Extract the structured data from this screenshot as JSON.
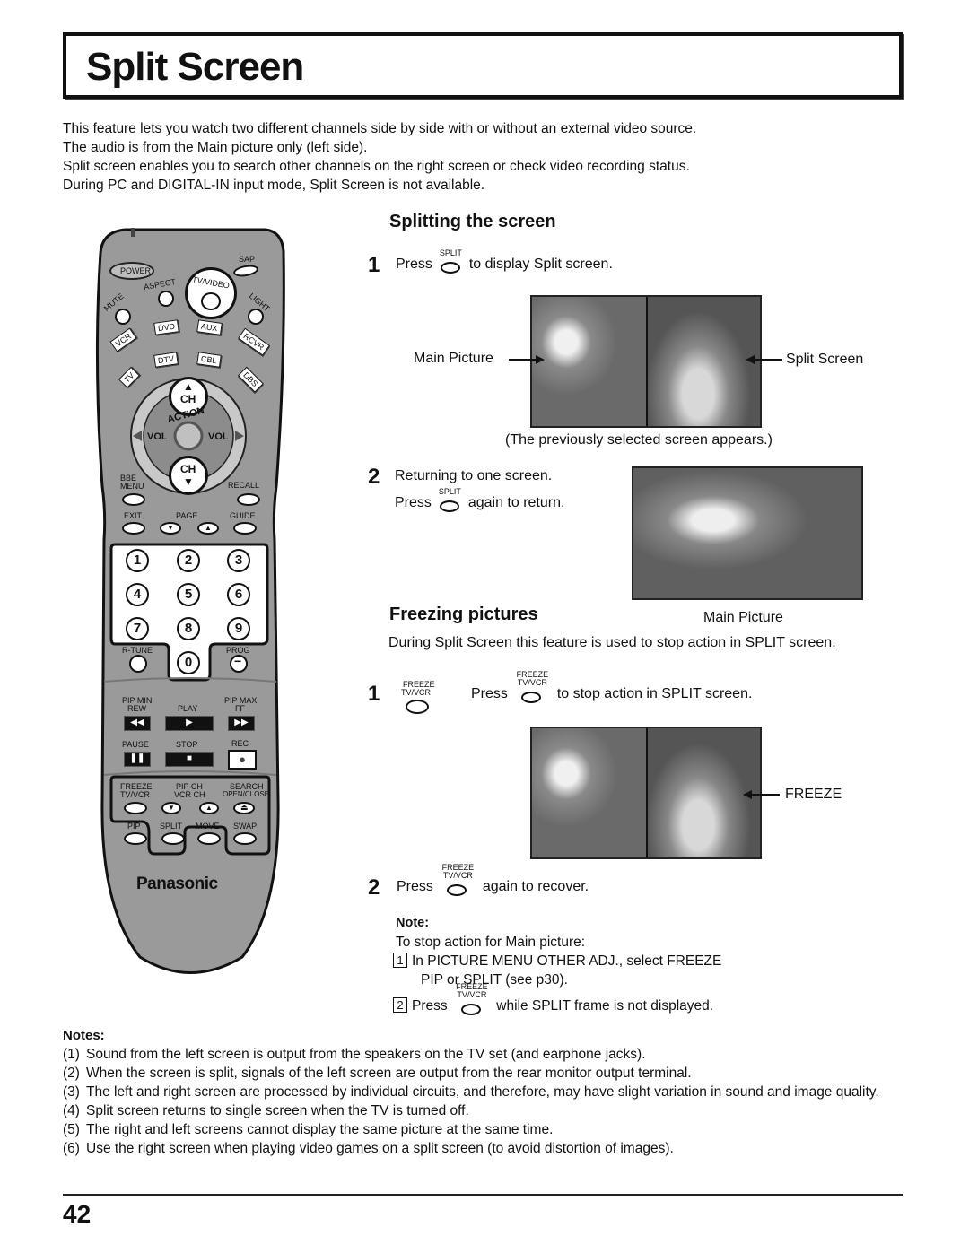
{
  "page": {
    "title": "Split Screen",
    "page_number": "42"
  },
  "intro": [
    "This feature lets you watch two different channels side by side with or without an external video source.",
    "The audio is from the Main picture only (left side).",
    "Split screen enables you to search other channels on the right screen or check video recording status.",
    "During PC and DIGITAL-IN input mode, Split Screen is not available."
  ],
  "splitting": {
    "heading": "Splitting the screen",
    "step1": {
      "num": "1",
      "press": "Press",
      "button": "SPLIT",
      "rest": "to display Split screen."
    },
    "label_main": "Main Picture",
    "label_split": "Split Screen",
    "caption": "(The previously selected screen appears.)",
    "step2": {
      "num": "2",
      "line1": "Returning to one screen.",
      "press": "Press",
      "button": "SPLIT",
      "rest": "again to return."
    },
    "single_caption": "Main Picture"
  },
  "freezing": {
    "heading": "Freezing pictures",
    "desc": "During Split Screen this feature is used to stop action in SPLIT screen.",
    "step1": {
      "num": "1",
      "icon_line1": "FREEZE",
      "icon_line2": "TV/VCR",
      "press": "Press",
      "btn_line1": "FREEZE",
      "btn_line2": "TV/VCR",
      "rest": "to stop action in SPLIT screen."
    },
    "freeze_label": "FREEZE",
    "step2": {
      "num": "2",
      "press": "Press",
      "btn_line1": "FREEZE",
      "btn_line2": "TV/VCR",
      "rest": "again to recover."
    }
  },
  "note": {
    "heading": "Note:",
    "intro": "To stop action for Main picture:",
    "items": [
      {
        "num": "1",
        "text": "In PICTURE MENU OTHER ADJ., select FREEZE",
        "text2": "PIP or SPLIT (see p30)."
      },
      {
        "num": "2",
        "press": "Press",
        "btn_line1": "FREEZE",
        "btn_line2": "TV/VCR",
        "rest": "while SPLIT frame is not displayed."
      }
    ]
  },
  "notes": {
    "heading": "Notes:",
    "items": [
      {
        "n": "(1)",
        "text": "Sound from the left screen is output from the speakers on the TV set (and earphone jacks)."
      },
      {
        "n": "(2)",
        "text": "When the screen is split, signals of the left screen are output from the rear monitor output terminal."
      },
      {
        "n": "(3)",
        "text": "The left and right screen are processed by individual circuits, and therefore, may have slight variation in sound and image quality."
      },
      {
        "n": "(4)",
        "text": "Split screen returns to single screen when the TV is turned off."
      },
      {
        "n": "(5)",
        "text": "The right and left screens cannot display the same picture at the same time."
      },
      {
        "n": "(6)",
        "text": "Use the right screen when playing video games on a split screen (to avoid distortion of images)."
      }
    ]
  },
  "remote": {
    "brand": "Panasonic",
    "power": "POWER",
    "sap": "SAP",
    "aspect": "ASPECT",
    "tv_video": "TV/VIDEO",
    "mute": "MUTE",
    "light": "LIGHT",
    "dvd": "DVD",
    "aux": "AUX",
    "vcr": "VCR",
    "rcvr": "RCVR",
    "dtv": "DTV",
    "cbl": "CBL",
    "tv": "TV",
    "dbs": "DBS",
    "ch": "CH",
    "action": "ACTION",
    "vol": "VOL",
    "bbe": "BBE",
    "menu": "MENU",
    "recall": "RECALL",
    "exit": "EXIT",
    "page": "PAGE",
    "guide": "GUIDE",
    "digits": [
      "1",
      "2",
      "3",
      "4",
      "5",
      "6",
      "7",
      "8",
      "9",
      "0"
    ],
    "rtune": "R-TUNE",
    "prog": "PROG",
    "pip_min": "PIP MIN",
    "rew": "REW",
    "play": "PLAY",
    "pip_max": "PIP MAX",
    "ff": "FF",
    "pause": "PAUSE",
    "stop": "STOP",
    "rec": "REC",
    "freeze": "FREEZE",
    "tv_vcr": "TV/VCR",
    "pip_ch": "PIP CH",
    "vcr_ch": "VCR CH",
    "search": "SEARCH",
    "open_close": "OPEN/CLOSE",
    "pip": "PIP",
    "split": "SPLIT",
    "move": "MOVE",
    "swap": "SWAP"
  }
}
